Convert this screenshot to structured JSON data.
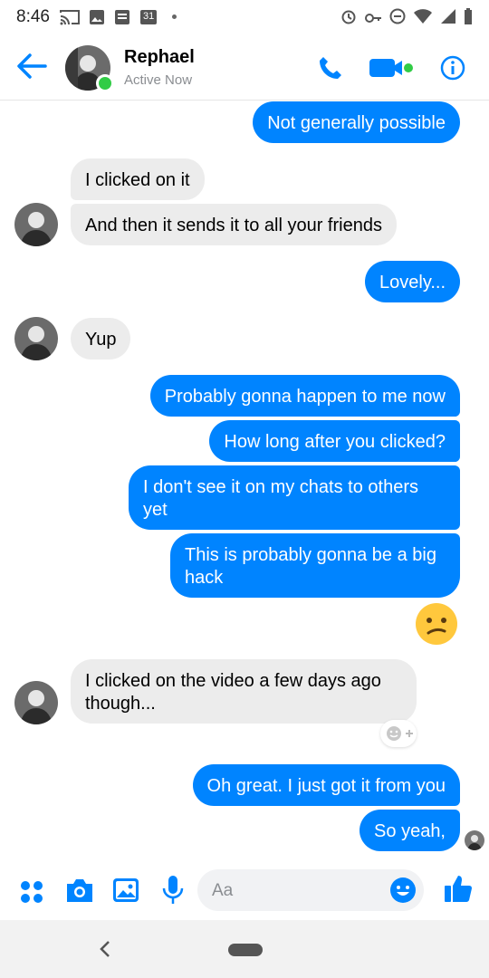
{
  "status_bar": {
    "time": "8:46",
    "date_badge": "31"
  },
  "header": {
    "name": "Rephael",
    "status": "Active Now"
  },
  "messages": [
    {
      "text": "Not generally possible"
    },
    {
      "text": "I clicked on it"
    },
    {
      "text": "And then it sends it to all your friends"
    },
    {
      "text": "Lovely..."
    },
    {
      "text": "Yup"
    },
    {
      "text": "Probably gonna happen to me now"
    },
    {
      "text": "How long after you clicked?"
    },
    {
      "text": "I don't see it on my chats to others yet"
    },
    {
      "text": "This is probably gonna be a big hack"
    },
    {
      "text": "I clicked on the video a few days ago though..."
    },
    {
      "text": "Oh great. I just got it from you"
    },
    {
      "text": "So yeah,"
    }
  ],
  "composer": {
    "placeholder": "Aa"
  },
  "colors": {
    "accent": "#0084ff",
    "incoming": "#ececec",
    "online": "#31cc46"
  },
  "icons": [
    "back-arrow-icon",
    "phone-icon",
    "video-icon",
    "info-icon",
    "apps-icon",
    "camera-icon",
    "gallery-icon",
    "mic-icon",
    "emoji-icon",
    "like-icon",
    "confused-emoji-icon",
    "add-reaction-icon"
  ]
}
